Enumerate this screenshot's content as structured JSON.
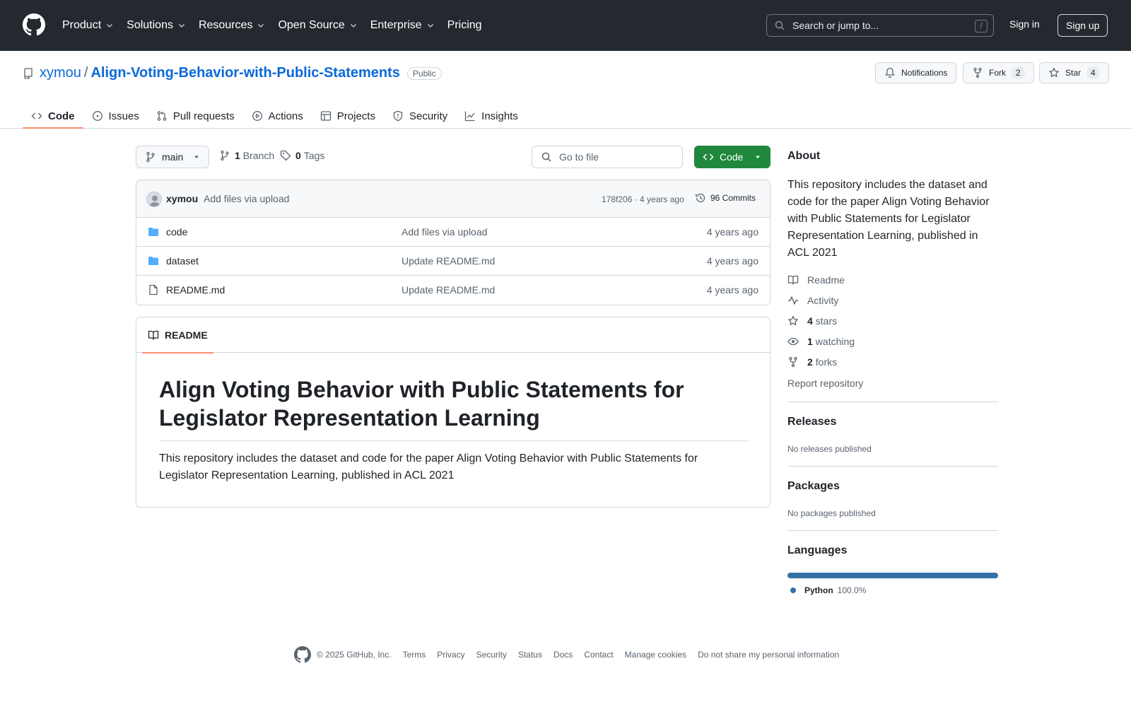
{
  "header": {
    "nav": [
      {
        "label": "Product",
        "has_menu": true
      },
      {
        "label": "Solutions",
        "has_menu": true
      },
      {
        "label": "Resources",
        "has_menu": true
      },
      {
        "label": "Open Source",
        "has_menu": true
      },
      {
        "label": "Enterprise",
        "has_menu": true
      },
      {
        "label": "Pricing",
        "has_menu": false
      }
    ],
    "search_placeholder": "Search or jump to...",
    "search_shortcut": "/",
    "sign_in": "Sign in",
    "sign_up": "Sign up"
  },
  "repo": {
    "owner": "xymou",
    "separator": "/",
    "name": "Align-Voting-Behavior-with-Public-Statements",
    "visibility": "Public",
    "notifications_label": "Notifications",
    "fork_label": "Fork",
    "fork_count": "2",
    "star_label": "Star",
    "star_count": "4"
  },
  "tabs": [
    {
      "label": "Code",
      "icon": "code-icon",
      "active": true
    },
    {
      "label": "Issues",
      "icon": "issue-icon",
      "active": false
    },
    {
      "label": "Pull requests",
      "icon": "pull-request-icon",
      "active": false
    },
    {
      "label": "Actions",
      "icon": "play-icon",
      "active": false
    },
    {
      "label": "Projects",
      "icon": "table-icon",
      "active": false
    },
    {
      "label": "Security",
      "icon": "shield-icon",
      "active": false
    },
    {
      "label": "Insights",
      "icon": "graph-icon",
      "active": false
    }
  ],
  "toolbar": {
    "branch": "main",
    "branch_count": "1",
    "branch_label": "Branch",
    "tag_count": "0",
    "tag_label": "Tags",
    "goto_placeholder": "Go to file",
    "code_button": "Code"
  },
  "latest_commit": {
    "user": "xymou",
    "message": "Add files via upload",
    "hash_time": "178f206 · 4 years ago",
    "commits_label": "96 Commits"
  },
  "files": [
    {
      "name": "code",
      "type": "folder",
      "message": "Add files via upload",
      "date": "4 years ago"
    },
    {
      "name": "dataset",
      "type": "folder",
      "message": "Update README.md",
      "date": "4 years ago"
    },
    {
      "name": "README.md",
      "type": "file",
      "message": "Update README.md",
      "date": "4 years ago"
    }
  ],
  "readme": {
    "tab_label": "README",
    "heading": "Align Voting Behavior with Public Statements for Legislator Representation Learning",
    "body": "This repository includes the dataset and code for the paper Align Voting Behavior with Public Statements for Legislator Representation Learning, published in ACL 2021"
  },
  "about": {
    "title": "About",
    "description": "This repository includes the dataset and code for the paper Align Voting Behavior with Public Statements for Legislator Representation Learning, published in ACL 2021",
    "readme": "Readme",
    "activity": "Activity",
    "stars_count": "4",
    "stars_label": "stars",
    "watching_count": "1",
    "watching_label": "watching",
    "forks_count": "2",
    "forks_label": "forks",
    "report": "Report repository"
  },
  "releases": {
    "title": "Releases",
    "text": "No releases published"
  },
  "packages": {
    "title": "Packages",
    "text": "No packages published"
  },
  "languages": {
    "title": "Languages",
    "items": [
      {
        "name": "Python",
        "percent": "100.0%",
        "color": "#3572a5"
      }
    ]
  },
  "footer": {
    "copyright": "© 2025 GitHub, Inc.",
    "links": [
      "Terms",
      "Privacy",
      "Security",
      "Status",
      "Docs",
      "Contact",
      "Manage cookies",
      "Do not share my personal information"
    ]
  },
  "colors": {
    "header_bg": "#24292f",
    "link": "#0969da",
    "code_button": "#1f883d",
    "tab_underline": "#fd8c73",
    "python": "#3572a5"
  }
}
